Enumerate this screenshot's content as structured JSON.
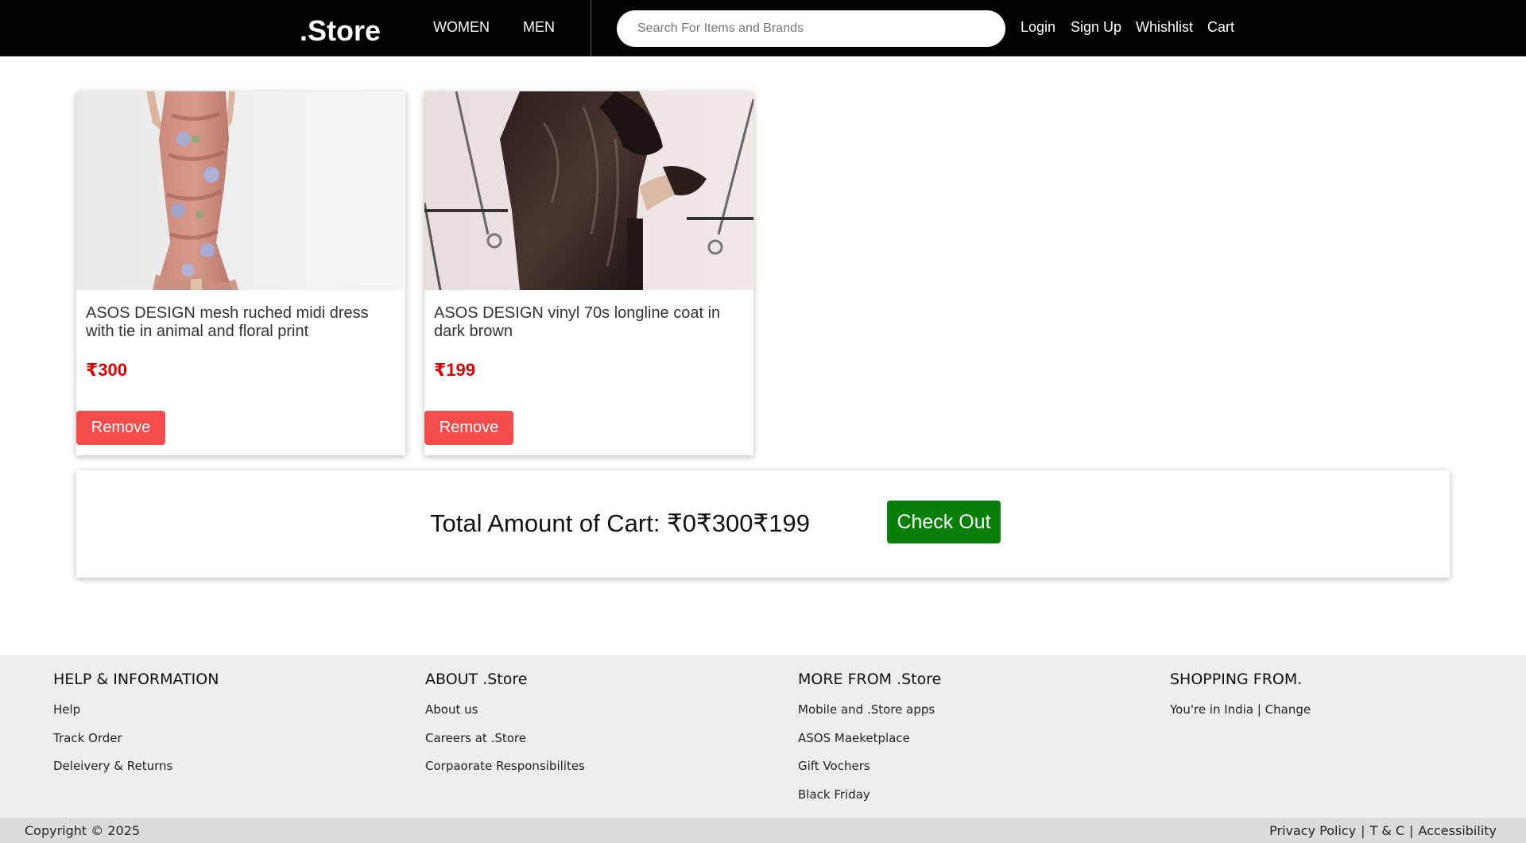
{
  "header": {
    "logo": ".Store",
    "nav": [
      "WOMEN",
      "MEN"
    ],
    "search_placeholder": "Search For Items and Brands",
    "links": {
      "login": "Login",
      "signup": "Sign Up",
      "wishlist": "Whishlist",
      "cart": "Cart"
    }
  },
  "cart": {
    "items": [
      {
        "title": "ASOS DESIGN mesh ruched midi dress with tie in animal and floral print",
        "price": "₹300",
        "remove_label": "Remove"
      },
      {
        "title": "ASOS DESIGN vinyl 70s longline coat in dark brown",
        "price": "₹199",
        "remove_label": "Remove"
      }
    ],
    "total_text": "Total Amount of Cart: ₹0₹300₹199",
    "checkout_label": "Check Out"
  },
  "footer": {
    "columns": [
      {
        "heading": "HELP & INFORMATION",
        "links": [
          "Help",
          "Track Order",
          "Deleivery & Returns"
        ]
      },
      {
        "heading": "ABOUT .Store",
        "links": [
          "About us",
          "Careers at .Store",
          "Corpaorate Responsibilites"
        ]
      },
      {
        "heading": "MORE FROM .Store",
        "links": [
          "Mobile and .Store apps",
          "ASOS Maeketplace",
          "Gift Vochers",
          "Black Friday"
        ]
      },
      {
        "heading": "SHOPPING FROM.",
        "links": [
          "You're in India | Change"
        ]
      }
    ],
    "copyright": "Copyright © 2025",
    "legal": [
      "Privacy Policy",
      "T & C",
      "Accessibility"
    ]
  },
  "colors": {
    "header_bg": "#000000",
    "price": "#e00000",
    "remove_button": "#f44b4b",
    "checkout_button": "#087f08",
    "footer_bg": "#eeeeee"
  }
}
